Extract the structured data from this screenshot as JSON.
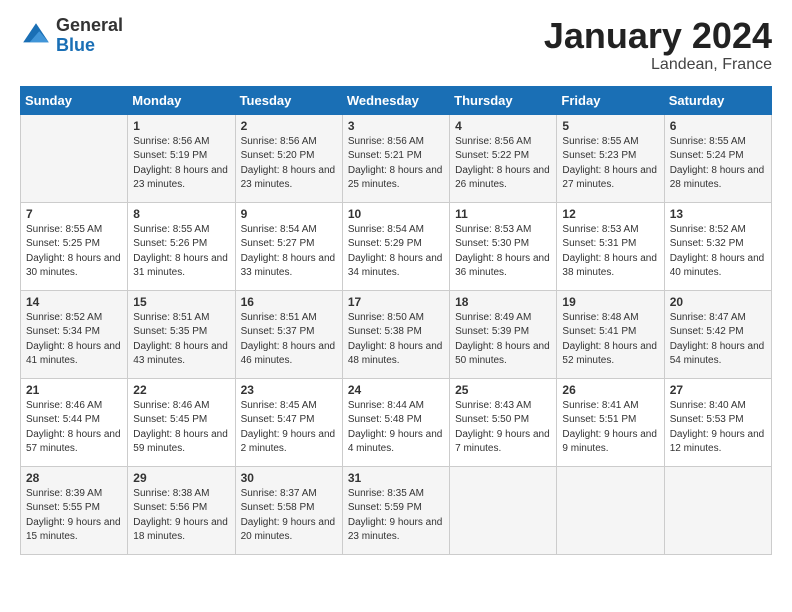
{
  "header": {
    "logo_general": "General",
    "logo_blue": "Blue",
    "title": "January 2024",
    "subtitle": "Landean, France"
  },
  "days_of_week": [
    "Sunday",
    "Monday",
    "Tuesday",
    "Wednesday",
    "Thursday",
    "Friday",
    "Saturday"
  ],
  "weeks": [
    [
      {
        "day": "",
        "sunrise": "",
        "sunset": "",
        "daylight": ""
      },
      {
        "day": "1",
        "sunrise": "Sunrise: 8:56 AM",
        "sunset": "Sunset: 5:19 PM",
        "daylight": "Daylight: 8 hours and 23 minutes."
      },
      {
        "day": "2",
        "sunrise": "Sunrise: 8:56 AM",
        "sunset": "Sunset: 5:20 PM",
        "daylight": "Daylight: 8 hours and 23 minutes."
      },
      {
        "day": "3",
        "sunrise": "Sunrise: 8:56 AM",
        "sunset": "Sunset: 5:21 PM",
        "daylight": "Daylight: 8 hours and 25 minutes."
      },
      {
        "day": "4",
        "sunrise": "Sunrise: 8:56 AM",
        "sunset": "Sunset: 5:22 PM",
        "daylight": "Daylight: 8 hours and 26 minutes."
      },
      {
        "day": "5",
        "sunrise": "Sunrise: 8:55 AM",
        "sunset": "Sunset: 5:23 PM",
        "daylight": "Daylight: 8 hours and 27 minutes."
      },
      {
        "day": "6",
        "sunrise": "Sunrise: 8:55 AM",
        "sunset": "Sunset: 5:24 PM",
        "daylight": "Daylight: 8 hours and 28 minutes."
      }
    ],
    [
      {
        "day": "7",
        "sunrise": "Sunrise: 8:55 AM",
        "sunset": "Sunset: 5:25 PM",
        "daylight": "Daylight: 8 hours and 30 minutes."
      },
      {
        "day": "8",
        "sunrise": "Sunrise: 8:55 AM",
        "sunset": "Sunset: 5:26 PM",
        "daylight": "Daylight: 8 hours and 31 minutes."
      },
      {
        "day": "9",
        "sunrise": "Sunrise: 8:54 AM",
        "sunset": "Sunset: 5:27 PM",
        "daylight": "Daylight: 8 hours and 33 minutes."
      },
      {
        "day": "10",
        "sunrise": "Sunrise: 8:54 AM",
        "sunset": "Sunset: 5:29 PM",
        "daylight": "Daylight: 8 hours and 34 minutes."
      },
      {
        "day": "11",
        "sunrise": "Sunrise: 8:53 AM",
        "sunset": "Sunset: 5:30 PM",
        "daylight": "Daylight: 8 hours and 36 minutes."
      },
      {
        "day": "12",
        "sunrise": "Sunrise: 8:53 AM",
        "sunset": "Sunset: 5:31 PM",
        "daylight": "Daylight: 8 hours and 38 minutes."
      },
      {
        "day": "13",
        "sunrise": "Sunrise: 8:52 AM",
        "sunset": "Sunset: 5:32 PM",
        "daylight": "Daylight: 8 hours and 40 minutes."
      }
    ],
    [
      {
        "day": "14",
        "sunrise": "Sunrise: 8:52 AM",
        "sunset": "Sunset: 5:34 PM",
        "daylight": "Daylight: 8 hours and 41 minutes."
      },
      {
        "day": "15",
        "sunrise": "Sunrise: 8:51 AM",
        "sunset": "Sunset: 5:35 PM",
        "daylight": "Daylight: 8 hours and 43 minutes."
      },
      {
        "day": "16",
        "sunrise": "Sunrise: 8:51 AM",
        "sunset": "Sunset: 5:37 PM",
        "daylight": "Daylight: 8 hours and 46 minutes."
      },
      {
        "day": "17",
        "sunrise": "Sunrise: 8:50 AM",
        "sunset": "Sunset: 5:38 PM",
        "daylight": "Daylight: 8 hours and 48 minutes."
      },
      {
        "day": "18",
        "sunrise": "Sunrise: 8:49 AM",
        "sunset": "Sunset: 5:39 PM",
        "daylight": "Daylight: 8 hours and 50 minutes."
      },
      {
        "day": "19",
        "sunrise": "Sunrise: 8:48 AM",
        "sunset": "Sunset: 5:41 PM",
        "daylight": "Daylight: 8 hours and 52 minutes."
      },
      {
        "day": "20",
        "sunrise": "Sunrise: 8:47 AM",
        "sunset": "Sunset: 5:42 PM",
        "daylight": "Daylight: 8 hours and 54 minutes."
      }
    ],
    [
      {
        "day": "21",
        "sunrise": "Sunrise: 8:46 AM",
        "sunset": "Sunset: 5:44 PM",
        "daylight": "Daylight: 8 hours and 57 minutes."
      },
      {
        "day": "22",
        "sunrise": "Sunrise: 8:46 AM",
        "sunset": "Sunset: 5:45 PM",
        "daylight": "Daylight: 8 hours and 59 minutes."
      },
      {
        "day": "23",
        "sunrise": "Sunrise: 8:45 AM",
        "sunset": "Sunset: 5:47 PM",
        "daylight": "Daylight: 9 hours and 2 minutes."
      },
      {
        "day": "24",
        "sunrise": "Sunrise: 8:44 AM",
        "sunset": "Sunset: 5:48 PM",
        "daylight": "Daylight: 9 hours and 4 minutes."
      },
      {
        "day": "25",
        "sunrise": "Sunrise: 8:43 AM",
        "sunset": "Sunset: 5:50 PM",
        "daylight": "Daylight: 9 hours and 7 minutes."
      },
      {
        "day": "26",
        "sunrise": "Sunrise: 8:41 AM",
        "sunset": "Sunset: 5:51 PM",
        "daylight": "Daylight: 9 hours and 9 minutes."
      },
      {
        "day": "27",
        "sunrise": "Sunrise: 8:40 AM",
        "sunset": "Sunset: 5:53 PM",
        "daylight": "Daylight: 9 hours and 12 minutes."
      }
    ],
    [
      {
        "day": "28",
        "sunrise": "Sunrise: 8:39 AM",
        "sunset": "Sunset: 5:55 PM",
        "daylight": "Daylight: 9 hours and 15 minutes."
      },
      {
        "day": "29",
        "sunrise": "Sunrise: 8:38 AM",
        "sunset": "Sunset: 5:56 PM",
        "daylight": "Daylight: 9 hours and 18 minutes."
      },
      {
        "day": "30",
        "sunrise": "Sunrise: 8:37 AM",
        "sunset": "Sunset: 5:58 PM",
        "daylight": "Daylight: 9 hours and 20 minutes."
      },
      {
        "day": "31",
        "sunrise": "Sunrise: 8:35 AM",
        "sunset": "Sunset: 5:59 PM",
        "daylight": "Daylight: 9 hours and 23 minutes."
      },
      {
        "day": "",
        "sunrise": "",
        "sunset": "",
        "daylight": ""
      },
      {
        "day": "",
        "sunrise": "",
        "sunset": "",
        "daylight": ""
      },
      {
        "day": "",
        "sunrise": "",
        "sunset": "",
        "daylight": ""
      }
    ]
  ]
}
